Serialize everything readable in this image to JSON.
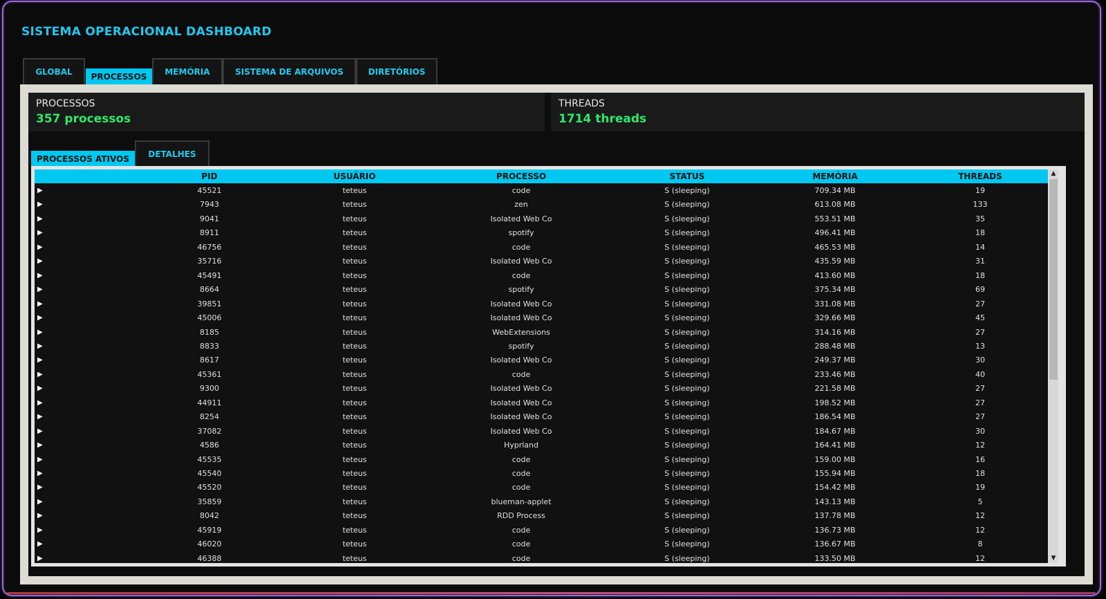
{
  "app": {
    "title": "SISTEMA OPERACIONAL DASHBOARD"
  },
  "main_tabs": [
    {
      "label": "GLOBAL",
      "active": false
    },
    {
      "label": "PROCESSOS",
      "active": true
    },
    {
      "label": "MEMÓRIA",
      "active": false
    },
    {
      "label": "SISTEMA DE ARQUIVOS",
      "active": false
    },
    {
      "label": "DIRETÓRIOS",
      "active": false
    }
  ],
  "stats": {
    "processes": {
      "label": "PROCESSOS",
      "value": "357 processos"
    },
    "threads": {
      "label": "THREADS",
      "value": "1714 threads"
    }
  },
  "sub_tabs": [
    {
      "label": "PROCESSOS ATIVOS",
      "active": true
    },
    {
      "label": "DETALHES",
      "active": false
    }
  ],
  "table": {
    "columns": [
      "PID",
      "USUÁRIO",
      "PROCESSO",
      "STATUS",
      "MEMÓRIA",
      "THREADS"
    ],
    "expand_glyph": "▶",
    "rows": [
      {
        "pid": "45521",
        "user": "teteus",
        "process": "code",
        "status": "S (sleeping)",
        "memory": "709.34 MB",
        "threads": "19"
      },
      {
        "pid": "7943",
        "user": "teteus",
        "process": "zen",
        "status": "S (sleeping)",
        "memory": "613.08 MB",
        "threads": "133"
      },
      {
        "pid": "9041",
        "user": "teteus",
        "process": "Isolated Web Co",
        "status": "S (sleeping)",
        "memory": "553.51 MB",
        "threads": "35"
      },
      {
        "pid": "8911",
        "user": "teteus",
        "process": "spotify",
        "status": "S (sleeping)",
        "memory": "496.41 MB",
        "threads": "18"
      },
      {
        "pid": "46756",
        "user": "teteus",
        "process": "code",
        "status": "S (sleeping)",
        "memory": "465.53 MB",
        "threads": "14"
      },
      {
        "pid": "35716",
        "user": "teteus",
        "process": "Isolated Web Co",
        "status": "S (sleeping)",
        "memory": "435.59 MB",
        "threads": "31"
      },
      {
        "pid": "45491",
        "user": "teteus",
        "process": "code",
        "status": "S (sleeping)",
        "memory": "413.60 MB",
        "threads": "18"
      },
      {
        "pid": "8664",
        "user": "teteus",
        "process": "spotify",
        "status": "S (sleeping)",
        "memory": "375.34 MB",
        "threads": "69"
      },
      {
        "pid": "39851",
        "user": "teteus",
        "process": "Isolated Web Co",
        "status": "S (sleeping)",
        "memory": "331.08 MB",
        "threads": "27"
      },
      {
        "pid": "45006",
        "user": "teteus",
        "process": "Isolated Web Co",
        "status": "S (sleeping)",
        "memory": "329.66 MB",
        "threads": "45"
      },
      {
        "pid": "8185",
        "user": "teteus",
        "process": "WebExtensions",
        "status": "S (sleeping)",
        "memory": "314.16 MB",
        "threads": "27"
      },
      {
        "pid": "8833",
        "user": "teteus",
        "process": "spotify",
        "status": "S (sleeping)",
        "memory": "288.48 MB",
        "threads": "13"
      },
      {
        "pid": "8617",
        "user": "teteus",
        "process": "Isolated Web Co",
        "status": "S (sleeping)",
        "memory": "249.37 MB",
        "threads": "30"
      },
      {
        "pid": "45361",
        "user": "teteus",
        "process": "code",
        "status": "S (sleeping)",
        "memory": "233.46 MB",
        "threads": "40"
      },
      {
        "pid": "9300",
        "user": "teteus",
        "process": "Isolated Web Co",
        "status": "S (sleeping)",
        "memory": "221.58 MB",
        "threads": "27"
      },
      {
        "pid": "44911",
        "user": "teteus",
        "process": "Isolated Web Co",
        "status": "S (sleeping)",
        "memory": "198.52 MB",
        "threads": "27"
      },
      {
        "pid": "8254",
        "user": "teteus",
        "process": "Isolated Web Co",
        "status": "S (sleeping)",
        "memory": "186.54 MB",
        "threads": "27"
      },
      {
        "pid": "37082",
        "user": "teteus",
        "process": "Isolated Web Co",
        "status": "S (sleeping)",
        "memory": "184.67 MB",
        "threads": "30"
      },
      {
        "pid": "4586",
        "user": "teteus",
        "process": "Hyprland",
        "status": "S (sleeping)",
        "memory": "164.41 MB",
        "threads": "12"
      },
      {
        "pid": "45535",
        "user": "teteus",
        "process": "code",
        "status": "S (sleeping)",
        "memory": "159.00 MB",
        "threads": "16"
      },
      {
        "pid": "45540",
        "user": "teteus",
        "process": "code",
        "status": "S (sleeping)",
        "memory": "155.94 MB",
        "threads": "18"
      },
      {
        "pid": "45520",
        "user": "teteus",
        "process": "code",
        "status": "S (sleeping)",
        "memory": "154.42 MB",
        "threads": "19"
      },
      {
        "pid": "35859",
        "user": "teteus",
        "process": "blueman-applet",
        "status": "S (sleeping)",
        "memory": "143.13 MB",
        "threads": "5"
      },
      {
        "pid": "8042",
        "user": "teteus",
        "process": "RDD Process",
        "status": "S (sleeping)",
        "memory": "137.78 MB",
        "threads": "12"
      },
      {
        "pid": "45919",
        "user": "teteus",
        "process": "code",
        "status": "S (sleeping)",
        "memory": "136.73 MB",
        "threads": "12"
      },
      {
        "pid": "46020",
        "user": "teteus",
        "process": "code",
        "status": "S (sleeping)",
        "memory": "136.67 MB",
        "threads": "8"
      },
      {
        "pid": "46388",
        "user": "teteus",
        "process": "code",
        "status": "S (sleeping)",
        "memory": "133.50 MB",
        "threads": "12"
      }
    ]
  },
  "scrollbar": {
    "up_glyph": "▲",
    "down_glyph": "▼",
    "position_fraction": 0.0
  }
}
